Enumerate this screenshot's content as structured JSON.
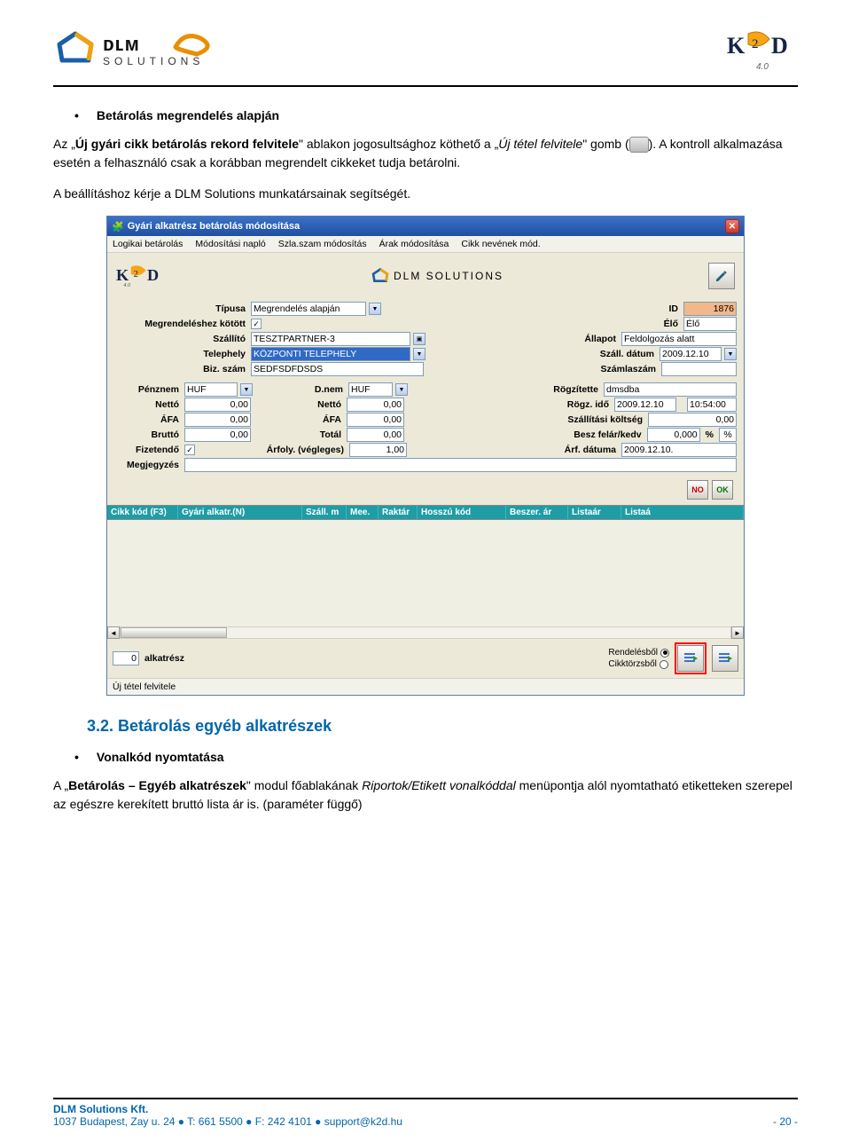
{
  "page": {
    "bullet1": "Betárolás megrendelés alapján",
    "para1_pre": "Az „",
    "para1_b1": "Új gyári cikk betárolás rekord felvitele",
    "para1_mid": "\" ablakon jogosultsághoz köthető a „",
    "para1_i1": "Új tétel felvitele",
    "para1_post": "\" gomb (",
    "para1_end": "). A kontroll alkalmazása esetén a felhasználó csak a korábban megrendelt cikkeket tudja betárolni.",
    "para2": "A beállításhoz kérje a DLM Solutions munkatársainak segítségét.",
    "heading": "3.2. Betárolás egyéb alkatrészek",
    "bullet2": "Vonalkód nyomtatása",
    "para3_pre": "A „",
    "para3_b1": "Betárolás – Egyéb alkatrészek",
    "para3_mid": "\" modul főablakának ",
    "para3_i1": "Riportok/Etikett vonalkóddal",
    "para3_post": " menüpontja alól nyomtatható etiketteken szerepel az egészre kerekített bruttó lista ár is. (paraméter függő)"
  },
  "footer": {
    "company": "DLM Solutions Kft.",
    "address": "1037 Budapest, Zay u. 24 ● T: 661 5500 ● F: 242 4101 ● support@k2d.hu",
    "page_num": "- 20 -"
  },
  "app": {
    "title": "Gyári alkatrész betárolás módosítása",
    "menu": {
      "m1": "Logikai betárolás",
      "m2": "Módosítási napló",
      "m3": "Szla.szam módosítás",
      "m4": "Árak módosítása",
      "m5": "Cikk nevének mód."
    },
    "labels": {
      "tipusa": "Típusa",
      "megrend": "Megrendeléshez kötött",
      "szallito": "Szállító",
      "telephely": "Telephely",
      "bizszam": "Biz. szám",
      "id": "ID",
      "elo": "Élő",
      "allapot": "Állapot",
      "szalldatum": "Száll. dátum",
      "szamlaszam": "Számlaszám",
      "penznem": "Pénznem",
      "netto": "Nettó",
      "afa": "ÁFA",
      "brutto": "Bruttó",
      "fizetendo": "Fizetendő",
      "megjegyzes": "Megjegyzés",
      "dnem": "D.nem",
      "total": "Totál",
      "arfoly": "Árfoly. (végleges)",
      "rogz": "Rögzítette",
      "rogzido": "Rögz. idő",
      "szallkts": "Szállítási költség",
      "beszfelar": "Besz felár/kedv",
      "arfdatum": "Árf. dátuma"
    },
    "values": {
      "tipusa": "Megrendelés alapján",
      "id": "1876",
      "elo": "Élő",
      "szallito": "TESZTPARTNER-3",
      "allapot": "Feldolgozás alatt",
      "telephely": "KÖZPONTI TELEPHELY",
      "szalldatum": "2009.12.10",
      "bizszam": "SEDFSDFDSDS",
      "penznem": "HUF",
      "dnem": "HUF",
      "netto": "0,00",
      "afa": "0,00",
      "brutto": "0,00",
      "total": "0,00",
      "arfoly": "1,00",
      "rogz": "dmsdba",
      "rogzido_date": "2009.12.10",
      "rogzido_time": "10:54:00",
      "szallkts": "0,00",
      "beszfelar": "0,000",
      "pct": "%",
      "arfdatum": "2009.12.10."
    },
    "grid": {
      "c1": "Cikk kód (F3)",
      "c2": "Gyári alkatr.(N)",
      "c3": "Száll. m",
      "c4": "Mee.",
      "c5": "Raktár",
      "c6": "Hosszú kód",
      "c7": "Beszer. ár",
      "c8": "Listaár",
      "c9": "Listaá"
    },
    "bottom": {
      "count": "0",
      "count_label": "alkatrész",
      "radio1": "Rendelésből",
      "radio2": "Cikktörzsből"
    },
    "status": "Új tétel felvitele",
    "no": "NO",
    "ok": "OK"
  }
}
